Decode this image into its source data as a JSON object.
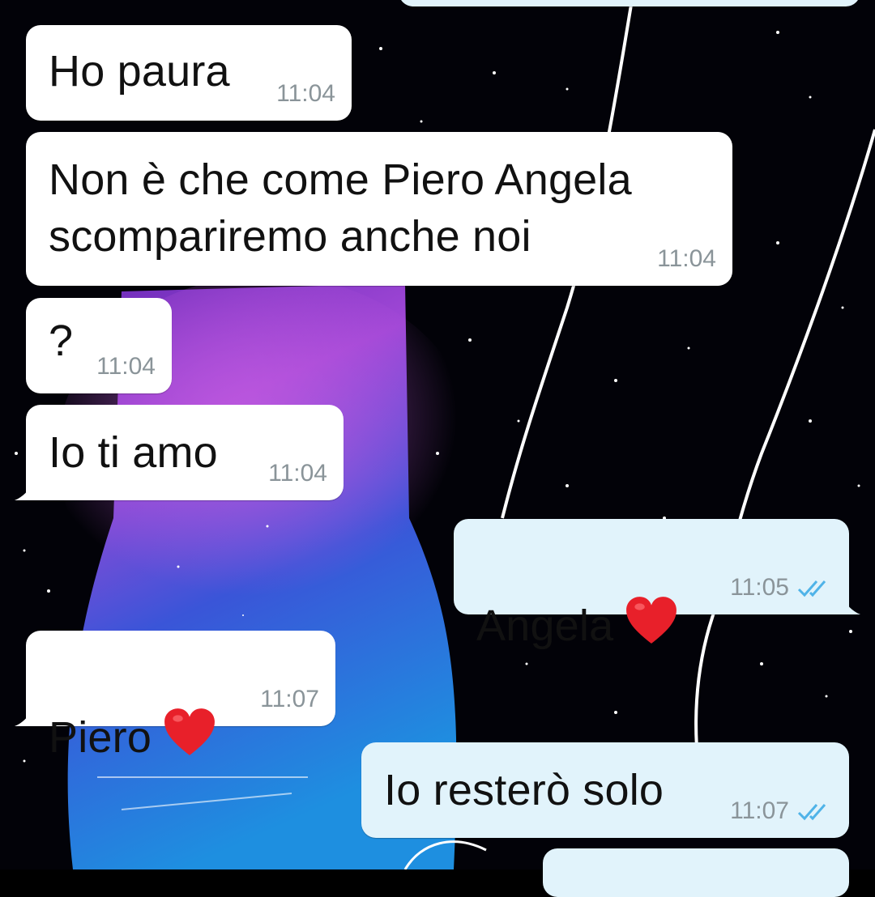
{
  "colors": {
    "incoming_bubble": "#ffffff",
    "outgoing_bubble": "#e1f3fb",
    "timestamp": "#8a9499",
    "read_ticks": "#4fb3e8",
    "heart": "#e8202a"
  },
  "messages": [
    {
      "direction": "incoming",
      "text": "Ho paura",
      "time": "11:04"
    },
    {
      "direction": "incoming",
      "text": "Non è che come Piero Angela\nscompariremo anche noi",
      "time": "11:04"
    },
    {
      "direction": "incoming",
      "text": "?",
      "time": "11:04"
    },
    {
      "direction": "incoming",
      "text": "Io ti amo",
      "time": "11:04"
    },
    {
      "direction": "outgoing",
      "text": "Angela",
      "emoji": "red-heart",
      "time": "11:05",
      "status": "read"
    },
    {
      "direction": "incoming",
      "text": "Piero",
      "emoji": "red-heart",
      "time": "11:07"
    },
    {
      "direction": "outgoing",
      "text": "Io resterò solo",
      "time": "11:07",
      "status": "read"
    },
    {
      "direction": "outgoing",
      "text": "",
      "time": "",
      "status": ""
    }
  ]
}
